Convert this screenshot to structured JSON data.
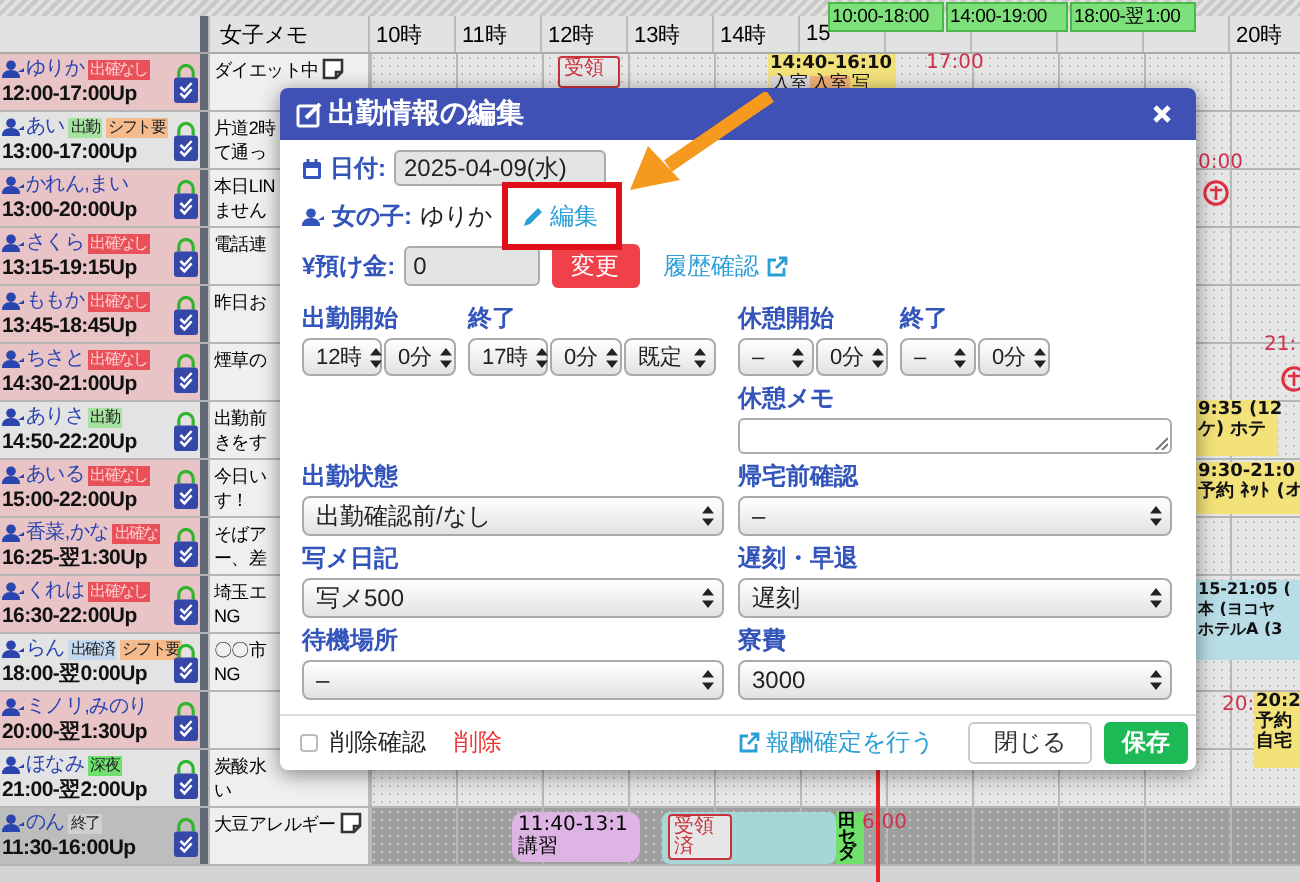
{
  "board": {
    "memo_header": "女子メモ",
    "hours": [
      "10時",
      "11時",
      "12時",
      "13時",
      "14時",
      "15",
      "20時"
    ],
    "staff": [
      {
        "name": "ゆりか",
        "time": "12:00-17:00Up",
        "kind": "highlighted",
        "tags": [
          {
            "text": "出確なし",
            "kind": "unconfirmed"
          }
        ],
        "memo": [
          "ダイエット中"
        ],
        "memo_note": true
      },
      {
        "name": "あい",
        "time": "13:00-17:00Up",
        "kind": "plain",
        "tags": [
          {
            "text": "出勤",
            "kind": "working"
          },
          {
            "text": "シフト要",
            "kind": "request"
          }
        ],
        "memo": [
          "片道2時",
          "て通っ"
        ],
        "memo_note": false
      },
      {
        "name": "かれん,まい",
        "time": "13:00-20:00Up",
        "kind": "highlighted",
        "memo": [
          "本日LIN",
          "ません"
        ],
        "memo_note": false
      },
      {
        "name": "さくら",
        "time": "13:15-19:15Up",
        "kind": "highlighted",
        "tags": [
          {
            "text": "出確なし",
            "kind": "unconfirmed"
          }
        ],
        "memo": [
          "電話連"
        ],
        "memo_note": false
      },
      {
        "name": "ももか",
        "time": "13:45-18:45Up",
        "kind": "highlighted",
        "tags": [
          {
            "text": "出確なし",
            "kind": "unconfirmed"
          }
        ],
        "memo": [
          "昨日お"
        ],
        "memo_note": false
      },
      {
        "name": "ちさと",
        "time": "14:30-21:00Up",
        "kind": "highlighted",
        "tags": [
          {
            "text": "出確なし",
            "kind": "unconfirmed"
          }
        ],
        "memo": [
          "煙草の"
        ],
        "memo_note": false
      },
      {
        "name": "ありさ",
        "time": "14:50-22:20Up",
        "kind": "plain",
        "tags": [
          {
            "text": "出勤",
            "kind": "working"
          }
        ],
        "memo": [
          "出勤前",
          "きをす"
        ],
        "memo_note": false
      },
      {
        "name": "あいる",
        "time": "15:00-22:00Up",
        "kind": "highlighted",
        "tags": [
          {
            "text": "出確なし",
            "kind": "unconfirmed"
          }
        ],
        "memo": [
          "今日い",
          "す！"
        ],
        "memo_note": false
      },
      {
        "name": "香菜,かな",
        "time": "16:25-翌1:30Up",
        "kind": "highlighted",
        "tags": [
          {
            "text": "出確な",
            "kind": "unconfirmed"
          }
        ],
        "memo": [
          "そばア",
          "ー、差"
        ],
        "memo_note": false
      },
      {
        "name": "くれは",
        "time": "16:30-22:00Up",
        "kind": "highlighted",
        "tags": [
          {
            "text": "出確なし",
            "kind": "unconfirmed"
          }
        ],
        "memo": [
          "埼玉エ",
          "NG"
        ],
        "memo_note": false
      },
      {
        "name": "らん",
        "time": "18:00-翌0:00Up",
        "kind": "plain",
        "tags": [
          {
            "text": "出確済",
            "kind": "confirmed"
          },
          {
            "text": "シフト要",
            "kind": "request"
          }
        ],
        "memo": [
          "〇〇市",
          "NG"
        ],
        "memo_note": false
      },
      {
        "name": "ミノリ,みのり",
        "time": "20:00-翌1:30Up",
        "kind": "highlighted",
        "memo_note": false
      },
      {
        "name": "ほなみ",
        "time": "21:00-翌2:00Up",
        "kind": "plain",
        "tags": [
          {
            "text": "深夜",
            "kind": "late-night"
          }
        ],
        "memo": [
          "炭酸水",
          "い"
        ],
        "memo_note": false
      },
      {
        "name": "のん",
        "time": "11:30-16:00Up",
        "kind": "ended",
        "tags": [
          {
            "text": "終了",
            "kind": "finished"
          }
        ],
        "memo": [
          "大豆アレルギー"
        ],
        "memo_note": true
      }
    ],
    "timeline_items": [
      {
        "kind": "shift",
        "lines": [
          "10:00-18:00"
        ]
      },
      {
        "kind": "shift",
        "lines": [
          "14:00-19:00"
        ]
      },
      {
        "kind": "shift",
        "lines": [
          "18:00-翌1:00"
        ]
      },
      {
        "kind": "receipt",
        "lines": [
          "受領"
        ]
      },
      {
        "kind": "booking",
        "lines": [
          "14:40-16:10"
        ],
        "tags": [
          {
            "text": "入室",
            "kind": "room"
          },
          {
            "text": "入室",
            "kind": "room-alt"
          },
          {
            "text": "写",
            "kind": "photo"
          }
        ]
      },
      {
        "kind": "time-mark",
        "lines": [
          "17:00"
        ]
      },
      {
        "kind": "time-mark",
        "lines": [
          "0:00"
        ]
      },
      {
        "kind": "stamp"
      },
      {
        "kind": "time-mark",
        "lines": [
          "21:"
        ]
      },
      {
        "kind": "stamp"
      },
      {
        "kind": "booking",
        "lines": [
          "9:35 (12",
          "ケ) ホテ"
        ]
      },
      {
        "kind": "booking",
        "lines": [
          "9:30-21:0",
          "予約 ﾈｯﾄ (オ"
        ]
      },
      {
        "kind": "booking-blue",
        "lines": [
          "15-21:05 (",
          "本 (ヨコヤ",
          "ホテルA (3"
        ]
      },
      {
        "kind": "time-mark",
        "lines": [
          "20:"
        ]
      },
      {
        "kind": "booking",
        "lines": [
          "20:2",
          "予約",
          "自宅"
        ]
      },
      {
        "kind": "lesson",
        "lines": [
          "11:40-13:1",
          "講習"
        ]
      },
      {
        "kind": "reserved"
      },
      {
        "kind": "receipt",
        "lines": [
          "受領",
          "済"
        ]
      },
      {
        "kind": "car",
        "lines": [
          "田",
          "セ",
          "ダ"
        ]
      },
      {
        "kind": "time-mark",
        "lines": [
          "6:00"
        ]
      }
    ]
  },
  "modal": {
    "title": "出勤情報の編集",
    "date": {
      "label": "日付:",
      "value": "2025-04-09(水)",
      "disabled": true
    },
    "girl": {
      "label": "女の子:",
      "value": "ゆりか",
      "link": "編集"
    },
    "deposit": {
      "label": "¥預け金:",
      "value": "0",
      "disabled": true,
      "button": "変更",
      "link": "履歴確認"
    },
    "work_time": [
      {
        "label": "出勤開始",
        "selects": [
          "12時",
          "0分"
        ]
      },
      {
        "label": "終了",
        "selects": [
          "17時",
          "0分",
          "既定"
        ]
      }
    ],
    "break_time": [
      {
        "label": "休憩開始",
        "selects": [
          "–",
          "0分"
        ]
      },
      {
        "label": "終了",
        "selects": [
          "–",
          "0分"
        ]
      }
    ],
    "break_memo": {
      "label": "休憩メモ"
    },
    "selects": [
      {
        "label": "出勤状態",
        "value": "出勤確認前/なし"
      },
      {
        "label": "帰宅前確認",
        "value": "–"
      },
      {
        "label": "写メ日記",
        "value": "写メ500"
      },
      {
        "label": "遅刻・早退",
        "value": "遅刻"
      },
      {
        "label": "待機場所",
        "value": "–"
      },
      {
        "label": "寮費",
        "value": "3000"
      }
    ],
    "delete_confirm": {
      "label": "削除確認",
      "checked": false
    },
    "delete_link": "削除",
    "reward_link": "報酬確定を行う",
    "close_button": "閉じる",
    "save_button": "保存"
  }
}
